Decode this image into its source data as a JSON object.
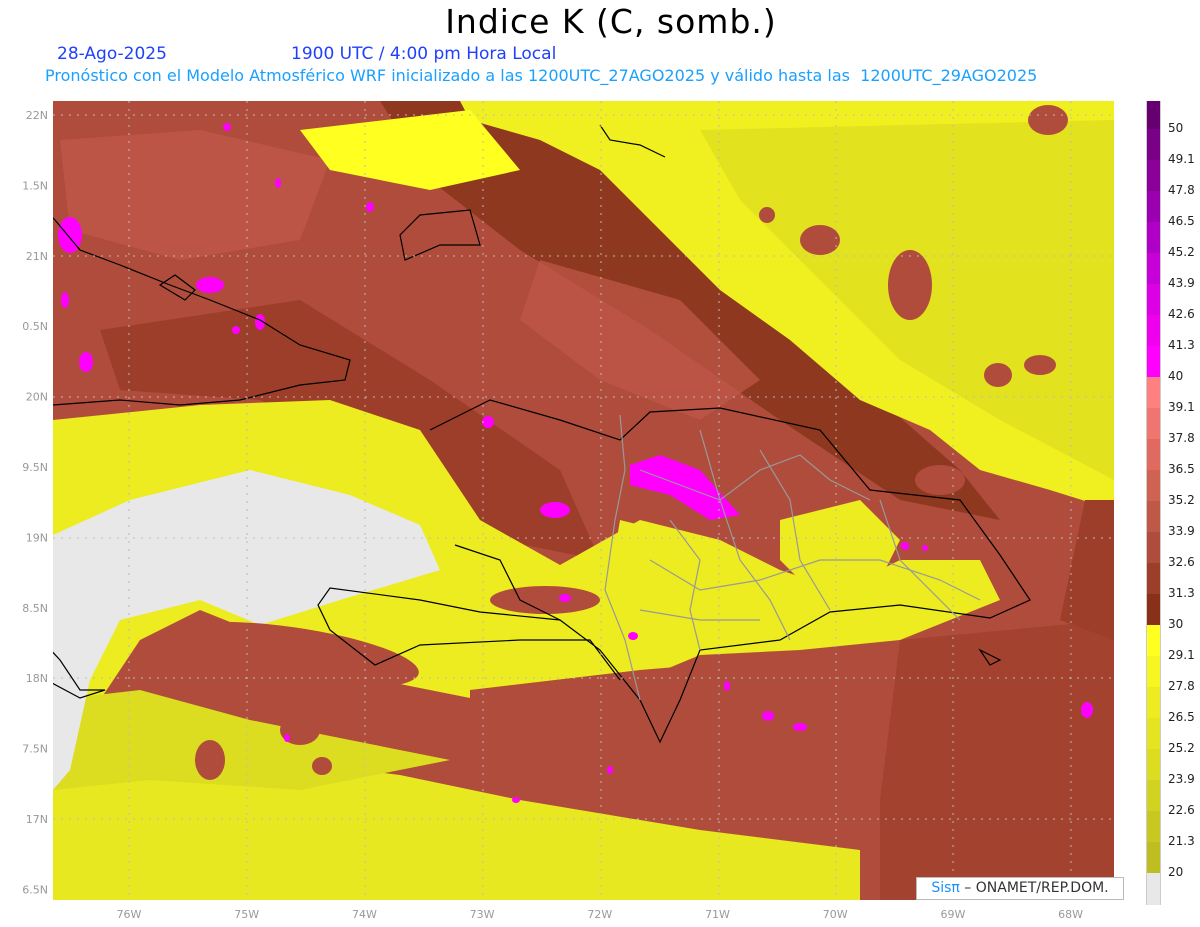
{
  "header": {
    "title": "Indice K (C, somb.)",
    "date": "28-Ago-2025",
    "time": "1900 UTC / 4:00 pm Hora Local",
    "subtitle": "Pronóstico con el Modelo Atmosférico WRF inicializado a las 1200UTC_27AGO2025 y válido hasta las  1200UTC_29AGO2025"
  },
  "map": {
    "longitude_labels": [
      "76W",
      "75W",
      "74W",
      "73W",
      "72W",
      "71W",
      "70W",
      "69W",
      "68W"
    ],
    "latitude_labels": [
      "22N",
      "1.5N",
      "21N",
      "0.5N",
      "20N",
      "9.5N",
      "19N",
      "8.5N",
      "18N",
      "7.5N",
      "17N",
      "6.5N"
    ]
  },
  "colorbar": {
    "labels": [
      "50",
      "49.1",
      "47.8",
      "46.5",
      "45.2",
      "43.9",
      "42.6",
      "41.3",
      "40",
      "39.1",
      "37.8",
      "36.5",
      "35.2",
      "33.9",
      "32.6",
      "31.3",
      "30",
      "29.1",
      "27.8",
      "26.5",
      "25.2",
      "23.9",
      "22.6",
      "21.3",
      "20"
    ],
    "colors": [
      "#660070",
      "#7a0088",
      "#8a0098",
      "#9a00b0",
      "#b000c8",
      "#c800d8",
      "#dc00e4",
      "#ee00ee",
      "#ff00ff",
      "#ff8080",
      "#f07570",
      "#e06a60",
      "#d06252",
      "#c05848",
      "#b04c3c",
      "#9c3e2a",
      "#883018",
      "#ffff20",
      "#f6f620",
      "#ecec20",
      "#e4e420",
      "#dcdc20",
      "#d2d220",
      "#c8c820",
      "#bebe20",
      "#e8e8e8"
    ]
  },
  "credit": {
    "brand": "Sisπ",
    "text": " –  ONAMET/REP.DOM."
  }
}
